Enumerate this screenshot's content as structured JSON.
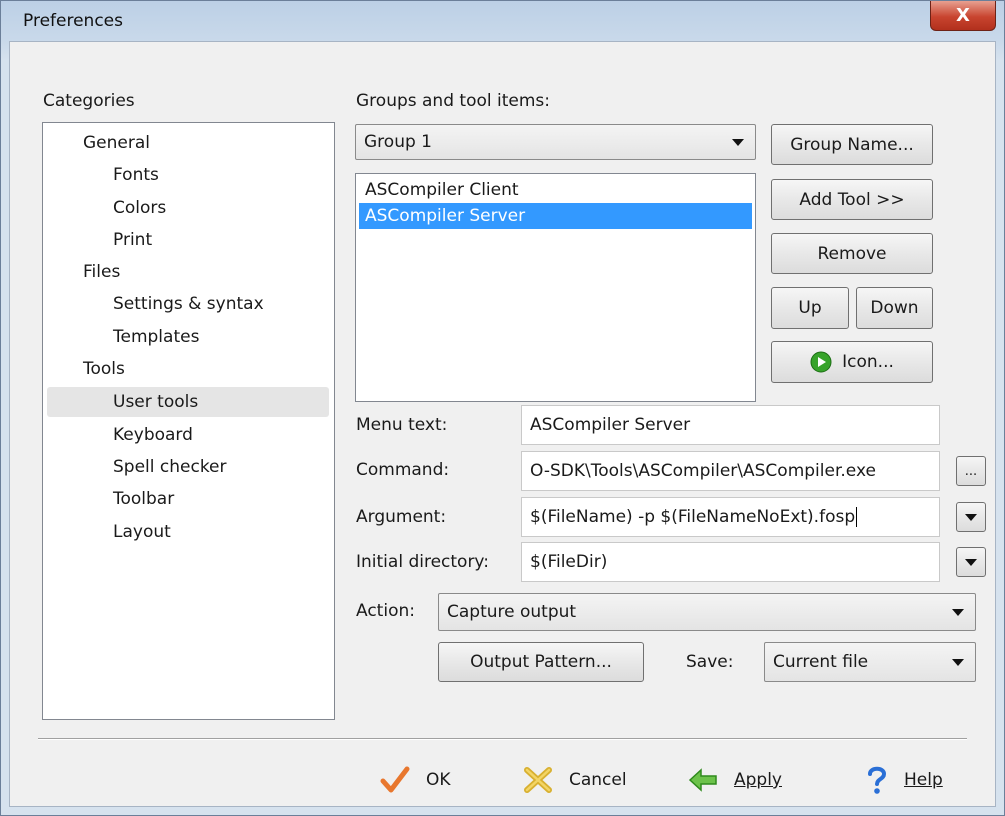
{
  "window": {
    "title": "Preferences",
    "close_glyph": "X"
  },
  "categories": {
    "label": "Categories",
    "items": [
      {
        "label": "General",
        "level": 0
      },
      {
        "label": "Fonts",
        "level": 1
      },
      {
        "label": "Colors",
        "level": 1
      },
      {
        "label": "Print",
        "level": 1
      },
      {
        "label": "Files",
        "level": 0
      },
      {
        "label": "Settings & syntax",
        "level": 1
      },
      {
        "label": "Templates",
        "level": 1
      },
      {
        "label": "Tools",
        "level": 0
      },
      {
        "label": "User tools",
        "level": 1,
        "selected": true
      },
      {
        "label": "Keyboard",
        "level": 1
      },
      {
        "label": "Spell checker",
        "level": 1
      },
      {
        "label": "Toolbar",
        "level": 1
      },
      {
        "label": "Layout",
        "level": 1
      }
    ]
  },
  "groups": {
    "label": "Groups and tool items:",
    "selected_group": "Group 1",
    "tools": [
      {
        "label": "ASCompiler Client",
        "selected": false
      },
      {
        "label": "ASCompiler  Server",
        "selected": true
      }
    ]
  },
  "buttons": {
    "group_name": "Group Name...",
    "add_tool": "Add Tool >>",
    "remove": "Remove",
    "up": "Up",
    "down": "Down",
    "icon": "Icon...",
    "browse": "...",
    "output_pattern": "Output Pattern..."
  },
  "form": {
    "menu_text_label": "Menu text:",
    "menu_text_value": "ASCompiler  Server",
    "command_label": "Command:",
    "command_value": "O-SDK\\Tools\\ASCompiler\\ASCompiler.exe",
    "argument_label": "Argument:",
    "argument_value": "$(FileName) -p $(FileNameNoExt).fosp",
    "initial_dir_label": "Initial directory:",
    "initial_dir_value": "$(FileDir)",
    "action_label": "Action:",
    "action_value": "Capture output",
    "save_label": "Save:",
    "save_value": "Current file"
  },
  "footer": {
    "ok": "OK",
    "cancel": "Cancel",
    "apply": "Apply",
    "help": "Help"
  },
  "colors": {
    "selection": "#3399ff",
    "ok_check": "#e8772e",
    "apply_arrow": "#3faa2a",
    "help_icon": "#2a6fd6"
  }
}
